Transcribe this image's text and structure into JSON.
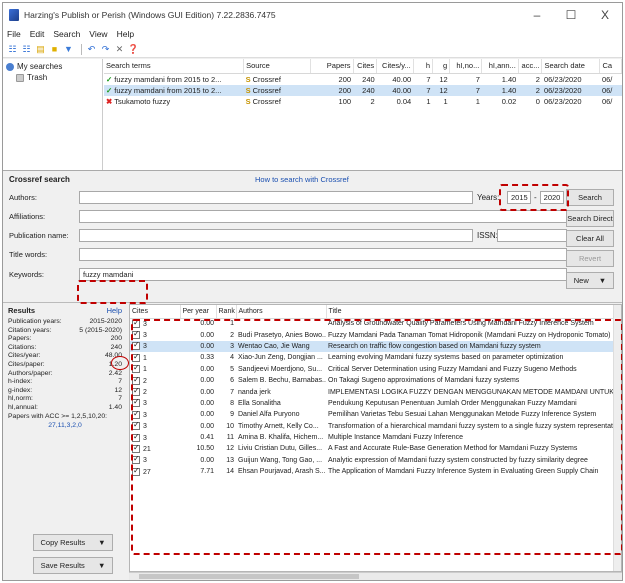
{
  "window": {
    "title": "Harzing's Publish or Perish (Windows GUI Edition) 7.22.2836.7475",
    "controls": [
      "–",
      "☐",
      "X"
    ]
  },
  "menu": [
    "File",
    "Edit",
    "Search",
    "View",
    "Help"
  ],
  "tree": {
    "root": "My searches",
    "child": "Trash"
  },
  "searches": {
    "columns": [
      "Search terms",
      "Source",
      "Papers",
      "Cites",
      "Cites/y...",
      "h",
      "g",
      "hI,no...",
      "hI,ann...",
      "acc...",
      "Search date",
      "Ca"
    ],
    "rows": [
      {
        "status": "ok",
        "term": "fuzzy mamdani from 2015 to 2...",
        "source": "Crossref",
        "papers": "200",
        "cites": "240",
        "cpy": "40.00",
        "h": "7",
        "g": "12",
        "hino": "7",
        "hiann": "1.40",
        "acc": "2",
        "date": "06/23/2020",
        "ca": "06/"
      },
      {
        "status": "ok",
        "term": "fuzzy mamdani from 2015 to 2...",
        "source": "Crossref",
        "papers": "200",
        "cites": "240",
        "cpy": "40.00",
        "h": "7",
        "g": "12",
        "hino": "7",
        "hiann": "1.40",
        "acc": "2",
        "date": "06/23/2020",
        "ca": "06/"
      },
      {
        "status": "bad",
        "term": "Tsukamoto fuzzy",
        "source": "Crossref",
        "papers": "100",
        "cites": "2",
        "cpy": "0.04",
        "h": "1",
        "g": "1",
        "hino": "1",
        "hiann": "0.02",
        "acc": "0",
        "date": "06/23/2020",
        "ca": "06/"
      }
    ]
  },
  "form": {
    "title": "Crossref search",
    "howto": "How to search with Crossref",
    "labels": {
      "authors": "Authors:",
      "affiliations": "Affiliations:",
      "publication": "Publication name:",
      "title_words": "Title words:",
      "keywords": "Keywords:",
      "issn": "ISSN:",
      "years": "Years:"
    },
    "values": {
      "year_from": "2015",
      "year_to": "2020",
      "keywords": "fuzzy mamdani"
    },
    "buttons": {
      "search": "Search",
      "search_direct": "Search Direct",
      "clear_all": "Clear All",
      "revert": "Revert",
      "new": "New"
    }
  },
  "stats": {
    "title": "Results",
    "help": "Help",
    "rows": [
      {
        "k": "Publication years:",
        "v": "2015-2020"
      },
      {
        "k": "Citation years:",
        "v": "5 (2015-2020)"
      },
      {
        "k": "Papers:",
        "v": "200"
      },
      {
        "k": "Citations:",
        "v": "240"
      },
      {
        "k": "Cites/year:",
        "v": "48.00"
      },
      {
        "k": "Cites/paper:",
        "v": "1.20"
      },
      {
        "k": "Authors/paper:",
        "v": "2.42"
      },
      {
        "k": "h-index:",
        "v": "7"
      },
      {
        "k": "g-index:",
        "v": "12"
      },
      {
        "k": "hI,norm:",
        "v": "7"
      },
      {
        "k": "hI,annual:",
        "v": "1.40"
      },
      {
        "k": "Papers with ACC >= 1,2,5,10,20:",
        "v": ""
      }
    ],
    "acc": "27,11,3,2,0",
    "copy_button": "Copy Results",
    "save_button": "Save Results"
  },
  "results": {
    "columns": [
      "Cites",
      "Per year",
      "Rank",
      "Authors",
      "Title"
    ],
    "rows": [
      {
        "cites": "3",
        "py": "0.00",
        "rank": "1",
        "authors": "",
        "title": "Analysis of Groundwater Quality Parameters Using Mamdani Fuzzy Inference System"
      },
      {
        "cites": "3",
        "py": "0.00",
        "rank": "2",
        "authors": "Budi Prasetyo, Anies Bowo...",
        "title": "Fuzzy Mamdani Pada Tanaman Tomat Hidroponik (Mamdani Fuzzy on Hydroponic Tomato)"
      },
      {
        "cites": "3",
        "py": "0.00",
        "rank": "3",
        "authors": "Wentao Cao, Jie Wang",
        "title": "Research on traffic flow congestion based on Mamdani fuzzy system"
      },
      {
        "cites": "1",
        "py": "0.33",
        "rank": "4",
        "authors": "Xiao-Jun Zeng, Dongjian ...",
        "title": "Learning evolving Mamdani fuzzy systems based on parameter optimization"
      },
      {
        "cites": "1",
        "py": "0.00",
        "rank": "5",
        "authors": "Sandjeevi Moerdjono, Su...",
        "title": "Critical Server Determination using Fuzzy Mamdani and Fuzzy Sugeno Methods"
      },
      {
        "cites": "2",
        "py": "0.00",
        "rank": "6",
        "authors": "Salem B. Bechu, Barnabas...",
        "title": "On Takagi Sugeno approximations of Mamdani fuzzy systems"
      },
      {
        "cites": "2",
        "py": "0.00",
        "rank": "7",
        "authors": "nanda jerk",
        "title": "IMPLEMENTASI LOGIKA FUZZY DENGAN MENGGUNAKAN METODE MAMDANI UNTUK"
      },
      {
        "cites": "3",
        "py": "0.00",
        "rank": "8",
        "authors": "Ella Sonalitha",
        "title": "Pendukung Keputusan Penentuan Jumlah Order Menggunakan Fuzzy Mamdani"
      },
      {
        "cites": "3",
        "py": "0.00",
        "rank": "9",
        "authors": "Daniel Alfa Puryono",
        "title": "Pemilihan Varietas Tebu Sesuai Lahan Menggunakan Metode Fuzzy Inference System"
      },
      {
        "cites": "3",
        "py": "0.00",
        "rank": "10",
        "authors": "Timothy Arnett, Kelly Co...",
        "title": "Transformation of a hierarchical mamdani fuzzy system to a single fuzzy system representation"
      },
      {
        "cites": "3",
        "py": "0.41",
        "rank": "11",
        "authors": "Amina B. Khalifa, Hichem...",
        "title": "Multiple Instance Mamdani Fuzzy Inference"
      },
      {
        "cites": "21",
        "py": "10.50",
        "rank": "12",
        "authors": "Liviu Cristian Dutu, Gilles...",
        "title": "A Fast and Accurate Rule-Base Generation Method for Mamdani Fuzzy Systems"
      },
      {
        "cites": "3",
        "py": "0.00",
        "rank": "13",
        "authors": "Guijun Wang, Tong Gao, ...",
        "title": "Analytic expression of Mamdani fuzzy system constructed by fuzzy similarity degree"
      },
      {
        "cites": "27",
        "py": "7.71",
        "rank": "14",
        "authors": "Ehsan Pourjavad, Arash S...",
        "title": "The Application of Mamdani Fuzzy Inference System in Evaluating Green Supply Chain"
      }
    ]
  }
}
